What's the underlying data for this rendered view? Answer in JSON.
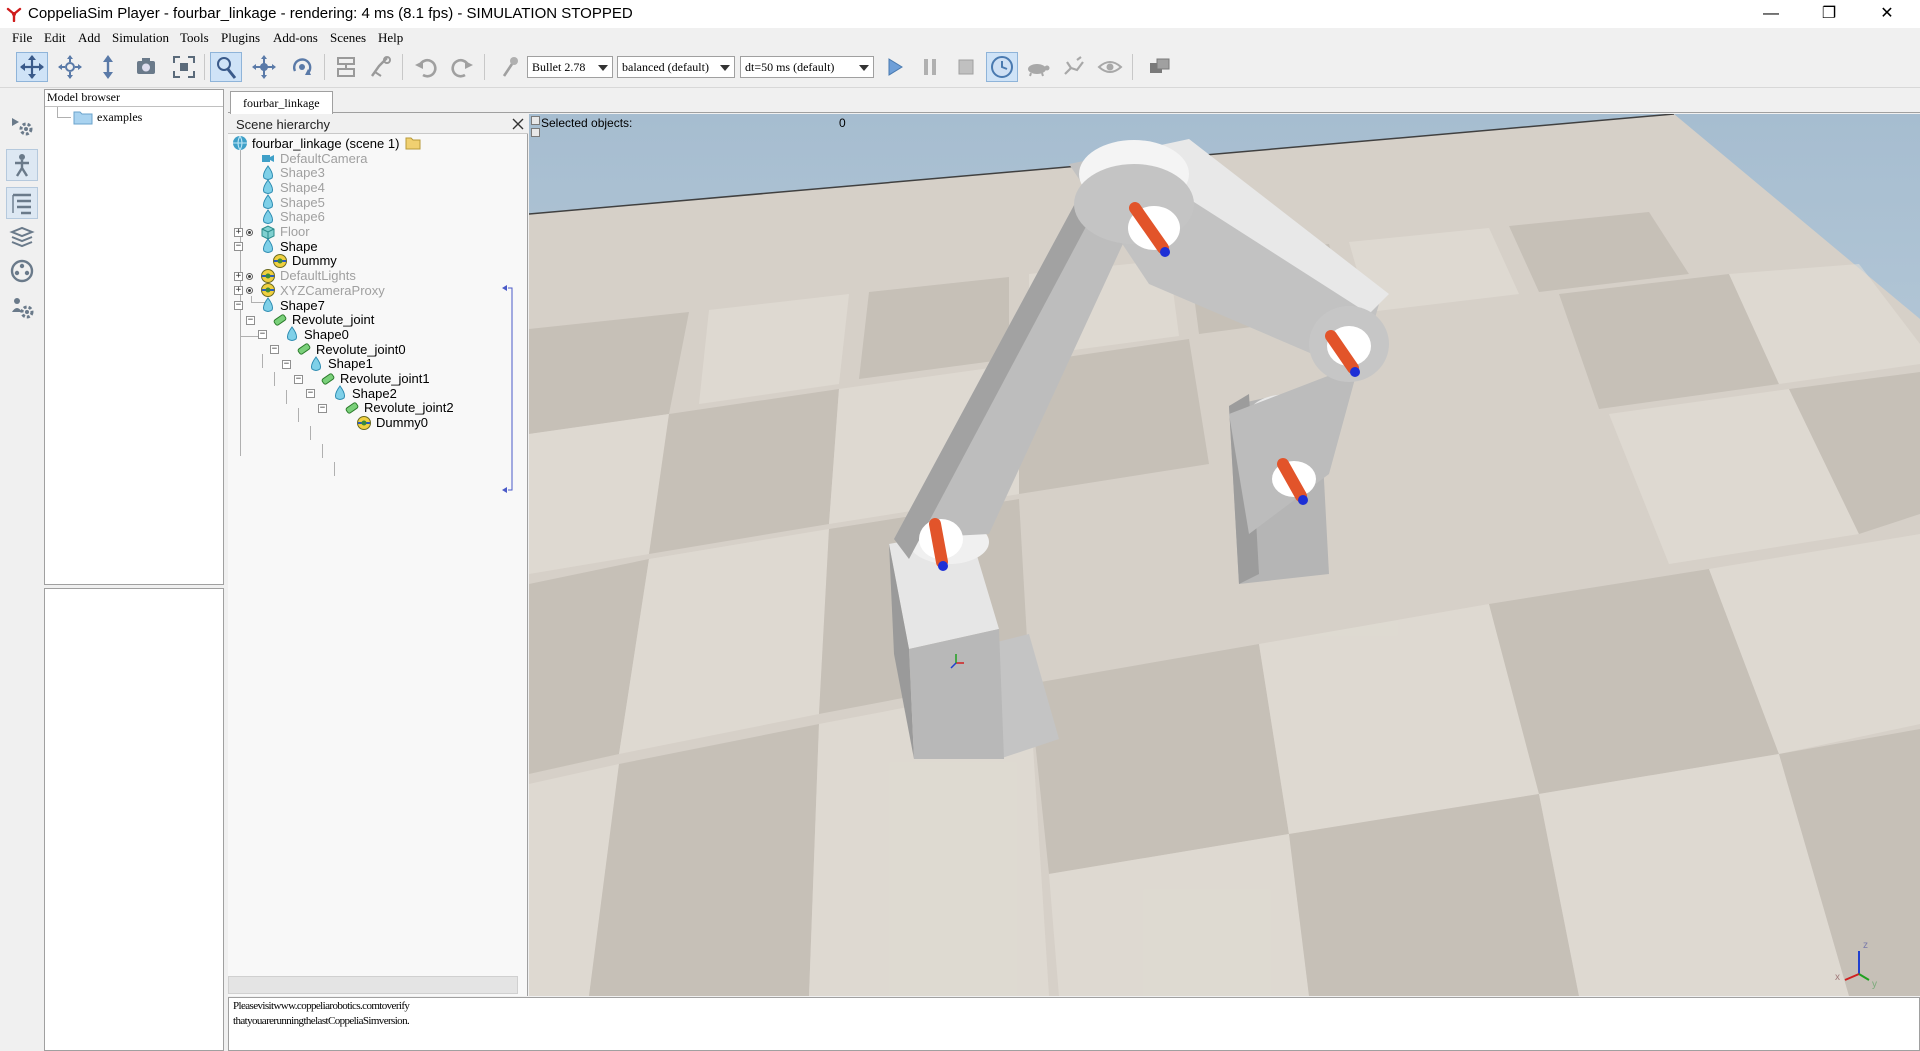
{
  "window": {
    "title": "CoppeliaSim Player - fourbar_linkage - rendering: 4 ms (8.1 fps) - SIMULATION STOPPED",
    "minimize": "—",
    "restore": "❐",
    "close": "✕"
  },
  "menu": [
    "File",
    "Edit",
    "Add",
    "Simulation",
    "Tools",
    "Plugins",
    "Add-ons",
    "Scenes",
    "Help"
  ],
  "toolbar": {
    "engine": "Bullet 2.78",
    "accuracy": "balanced (default)",
    "timestep": "dt=50 ms (default)",
    "icons": [
      "camera-pan-icon",
      "camera-rotate-icon",
      "camera-shift-icon",
      "camera-angle-icon",
      "camera-fit-icon",
      "click-select-icon",
      "object-shift-icon",
      "object-rotate-icon",
      "assemble-icon",
      "transfer-dna-icon",
      "undo-icon",
      "redo-icon",
      "dynamics-icon",
      "start-simulation-icon",
      "pause-simulation-icon",
      "stop-simulation-icon",
      "real-time-icon",
      "slower-icon",
      "faster-icon",
      "visualization-icon",
      "page-selector-icon"
    ]
  },
  "model_browser": {
    "header": "Model browser",
    "folder": "examples"
  },
  "scene_tab": "fourbar_linkage",
  "hierarchy": {
    "title": "Scene hierarchy",
    "root": "fourbar_linkage (scene 1)",
    "items": [
      {
        "label": "DefaultCamera",
        "icon": "camera-icon",
        "grey": true
      },
      {
        "label": "Shape3",
        "icon": "shape-icon",
        "grey": true
      },
      {
        "label": "Shape4",
        "icon": "shape-icon",
        "grey": true
      },
      {
        "label": "Shape5",
        "icon": "shape-icon",
        "grey": true
      },
      {
        "label": "Shape6",
        "icon": "shape-icon",
        "grey": true
      },
      {
        "label": "Floor",
        "icon": "model-icon",
        "grey": true
      },
      {
        "label": "Shape",
        "icon": "shape-icon",
        "grey": false
      },
      {
        "label": "Dummy",
        "icon": "dummy-icon",
        "grey": false
      },
      {
        "label": "DefaultLights",
        "icon": "dummy-icon",
        "grey": true
      },
      {
        "label": "XYZCameraProxy",
        "icon": "dummy-icon",
        "grey": true
      },
      {
        "label": "Shape7",
        "icon": "shape-icon",
        "grey": false
      },
      {
        "label": "Revolute_joint",
        "icon": "joint-icon",
        "grey": false
      },
      {
        "label": "Shape0",
        "icon": "shape-icon",
        "grey": false
      },
      {
        "label": "Revolute_joint0",
        "icon": "joint-icon",
        "grey": false
      },
      {
        "label": "Shape1",
        "icon": "shape-icon",
        "grey": false
      },
      {
        "label": "Revolute_joint1",
        "icon": "joint-icon",
        "grey": false
      },
      {
        "label": "Shape2",
        "icon": "shape-icon",
        "grey": false
      },
      {
        "label": "Revolute_joint2",
        "icon": "joint-icon",
        "grey": false
      },
      {
        "label": "Dummy0",
        "icon": "dummy-icon",
        "grey": false
      }
    ]
  },
  "viewport": {
    "selected_label": "Selected objects:",
    "selected_count": "0",
    "axis_x": "x",
    "axis_y": "y",
    "axis_z": "z"
  },
  "console": {
    "line1": "Pleasevisitwww.coppeliarobotics.comtoverify",
    "line2": "thatyouarerunningthelastCoppeliaSimversion."
  }
}
